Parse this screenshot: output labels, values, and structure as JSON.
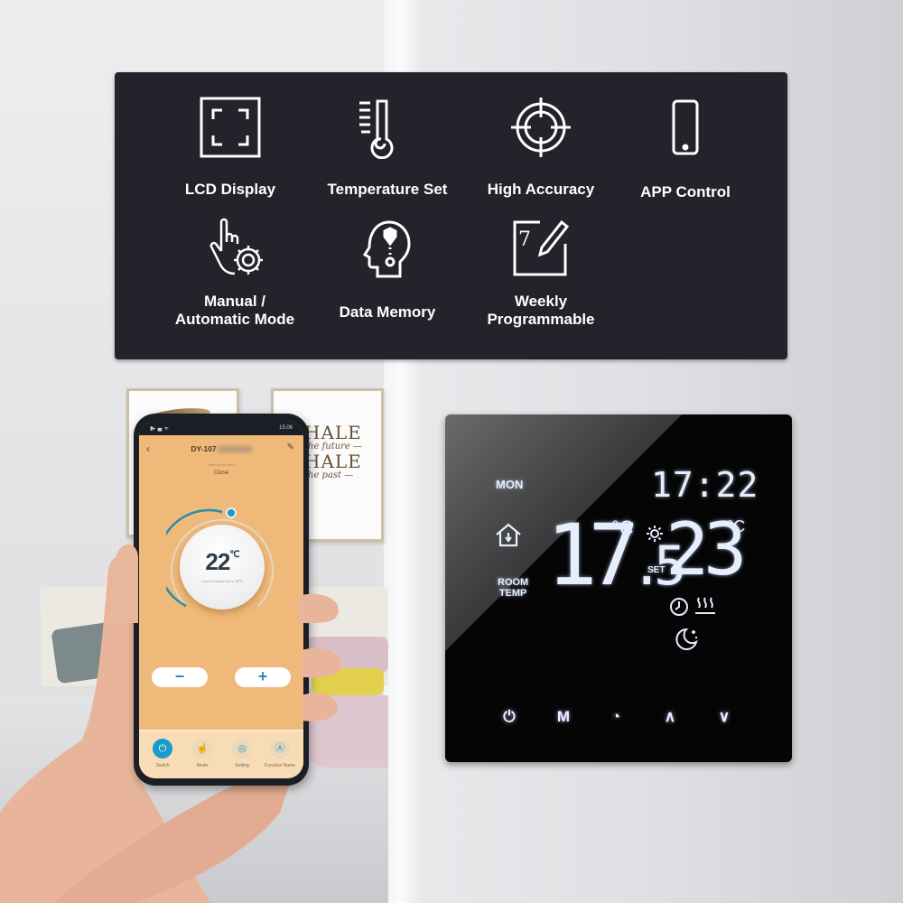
{
  "features": [
    {
      "icon": "lcd-display-icon",
      "label": "LCD Display"
    },
    {
      "icon": "thermometer-icon",
      "label": "Temperature Set"
    },
    {
      "icon": "crosshair-target-icon",
      "label": "High Accuracy"
    },
    {
      "icon": "smartphone-icon",
      "label": "APP Control"
    },
    {
      "icon": "hand-gear-icon",
      "label_line1": "Manual /",
      "label_line2": "Automatic Mode"
    },
    {
      "icon": "head-memory-icon",
      "label": "Data Memory"
    },
    {
      "icon": "calendar-pen-icon",
      "label_line1": "Weekly",
      "label_line2": "Programmable"
    }
  ],
  "background": {
    "painting_quote": {
      "line1": "HALE",
      "line2": "the future —",
      "line3": "HALE",
      "line4": "the past —"
    }
  },
  "phone_app": {
    "status_bar": {
      "left": "▮▸▗▖ᯤ",
      "time": "15:06"
    },
    "header": {
      "back_icon": "‹",
      "device_name": "DY-107",
      "edit_icon": "✎"
    },
    "valve": {
      "caption": "State of the valve",
      "state": "Close"
    },
    "dial": {
      "set_temp": "22",
      "unit": "℃",
      "current_temp_text": "Current temperature 28℃",
      "accent": "#2a8fa8",
      "knob_color": "#1a9bcc"
    },
    "buttons": {
      "minus": "−",
      "plus": "+"
    },
    "tabs": [
      {
        "icon": "power-icon",
        "glyph": "⏻",
        "label": "Switch",
        "active": true
      },
      {
        "icon": "hand-icon",
        "glyph": "☝",
        "label": "Mode",
        "active": false
      },
      {
        "icon": "settings-icon",
        "glyph": "◎",
        "label": "Setting",
        "active": false
      },
      {
        "icon": "function-icon",
        "glyph": "Ⓐ",
        "label": "Function Name",
        "active": false
      }
    ],
    "background_color": "#efb979"
  },
  "thermostat": {
    "day": "MON",
    "time": "17:22",
    "room_temp_int": "17",
    "room_temp_dec": ".5",
    "room_temp_unit": "°C",
    "room_temp_label_line1": "ROOM",
    "room_temp_label_line2": "TEMP",
    "set_label": "SET",
    "set_temp": "23",
    "set_temp_unit": "°C",
    "buttons": [
      {
        "name": "power",
        "glyph": "⏻"
      },
      {
        "name": "mode",
        "glyph": "M"
      },
      {
        "name": "clock",
        "glyph": "◔"
      },
      {
        "name": "up",
        "glyph": "∧"
      },
      {
        "name": "down",
        "glyph": "∨"
      }
    ]
  }
}
